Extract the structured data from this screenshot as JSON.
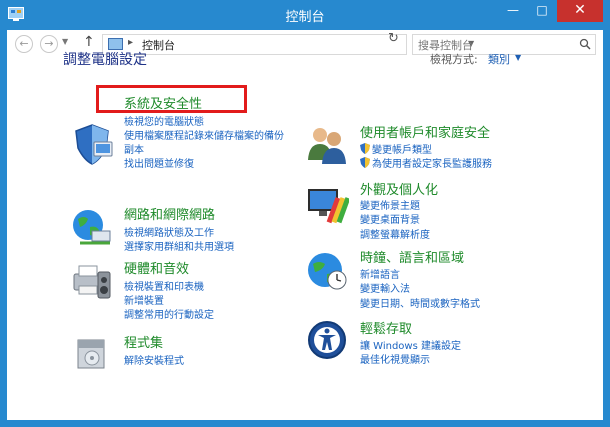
{
  "window": {
    "title": "控制台",
    "min_glyph": "—",
    "max_glyph": "□",
    "close_glyph": "✕"
  },
  "navbar": {
    "address": "控制台",
    "search_placeholder": "搜尋控制台"
  },
  "heading": "調整電腦設定",
  "view_by": {
    "label": "檢視方式:",
    "value": "類別"
  },
  "categories": {
    "system": {
      "title": "系統及安全性",
      "links": [
        "檢視您的電腦狀態",
        "使用檔案歷程記錄來儲存檔案的備份",
        "副本",
        "找出問題並修復"
      ]
    },
    "network": {
      "title": "網路和網際網路",
      "links": [
        "檢視網路狀態及工作",
        "選擇家用群組和共用選項"
      ]
    },
    "hardware": {
      "title": "硬體和音效",
      "links": [
        "檢視裝置和印表機",
        "新增裝置",
        "調整常用的行動設定"
      ]
    },
    "programs": {
      "title": "程式集",
      "links": [
        "解除安裝程式"
      ]
    },
    "users": {
      "title": "使用者帳戶和家庭安全",
      "links": [
        "變更帳戶類型",
        "為使用者設定家長監護服務"
      ]
    },
    "appearance": {
      "title": "外觀及個人化",
      "links": [
        "變更佈景主題",
        "變更桌面背景",
        "調整螢幕解析度"
      ]
    },
    "clock": {
      "title": "時鐘、語言和區域",
      "links": [
        "新增語言",
        "變更輸入法",
        "變更日期、時間或數字格式"
      ]
    },
    "access": {
      "title": "輕鬆存取",
      "links": [
        "讓 Windows 建議設定",
        "最佳化視覺顯示"
      ]
    }
  },
  "colors": {
    "title_bar": "#2789cf",
    "category_title": "#1e8a2a",
    "link": "#1a63c0",
    "highlight": "#e21b1b",
    "close_button": "#c7312d"
  }
}
